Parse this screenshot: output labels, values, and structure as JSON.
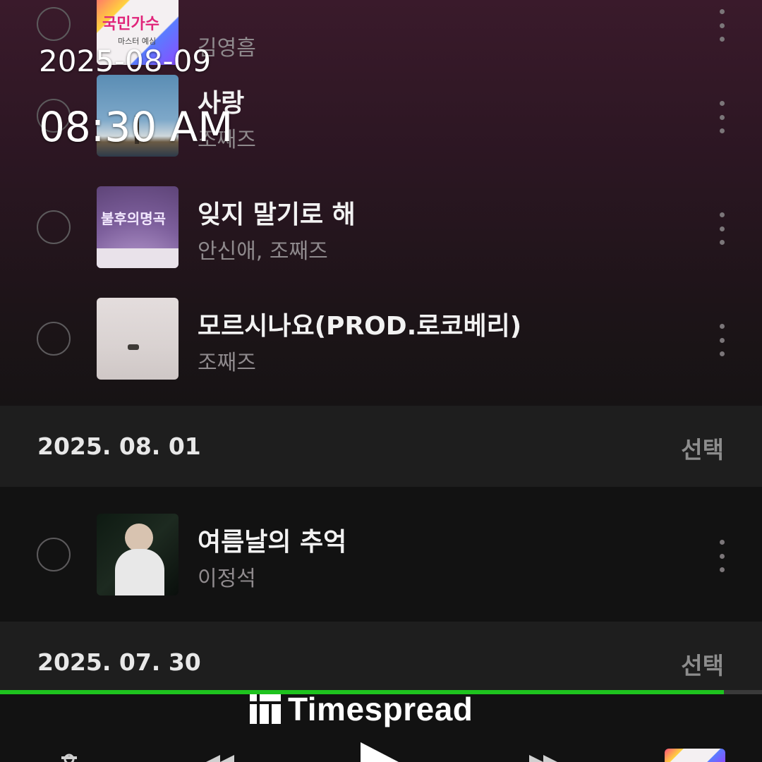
{
  "overlay": {
    "date": "2025-08-09",
    "time": "08:30 AM"
  },
  "groups": [
    {
      "songs": [
        {
          "title": "",
          "artist": "김영흠",
          "cover_text": "국민가수",
          "cover_subtext": "마스터 예심"
        },
        {
          "title": "사랑",
          "artist": "조째즈"
        },
        {
          "title": "잊지 말기로 해",
          "artist": "안신애, 조째즈",
          "cover_text": "불후의명곡"
        },
        {
          "title": "모르시나요(PROD.로코베리)",
          "artist": "조째즈"
        }
      ]
    },
    {
      "date": "2025. 08. 01",
      "select_label": "선택",
      "songs": [
        {
          "title": "여름날의 추억",
          "artist": "이정석"
        }
      ]
    },
    {
      "date": "2025. 07. 30",
      "select_label": "선택"
    }
  ],
  "player": {
    "progress": 0.95,
    "brand_name": "Timespread",
    "accent_color": "#1ec31e",
    "icons": [
      "playlist-icon",
      "previous-icon",
      "play-icon",
      "next-icon",
      "album-thumbnail"
    ]
  }
}
